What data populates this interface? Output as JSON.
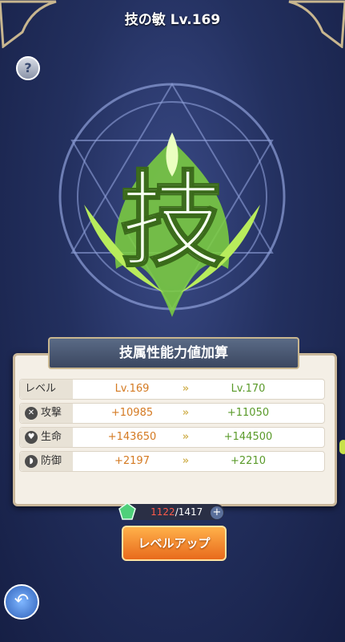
{
  "header": {
    "title": "技の敏 Lv.169"
  },
  "emblem": {
    "kanji": "技"
  },
  "panel": {
    "title": "技属性能力値加算",
    "rows": [
      {
        "label": "レベル",
        "current": "Lv.169",
        "next": "Lv.170",
        "icon": ""
      },
      {
        "label": "攻撃",
        "current": "+10985",
        "next": "+11050",
        "icon": "sword-icon"
      },
      {
        "label": "生命",
        "current": "+143650",
        "next": "+144500",
        "icon": "heart-icon"
      },
      {
        "label": "防御",
        "current": "+2197",
        "next": "+2210",
        "icon": "shield-icon"
      }
    ],
    "arrow": "»"
  },
  "cost": {
    "have": "1122",
    "need": "/1417"
  },
  "buttons": {
    "levelup": "レベルアップ",
    "help": "?",
    "plus": "+"
  },
  "colors": {
    "accent": "#e86a1c",
    "current": "#d47a22",
    "next": "#5a9a2a",
    "have": "#ff5a4a"
  }
}
